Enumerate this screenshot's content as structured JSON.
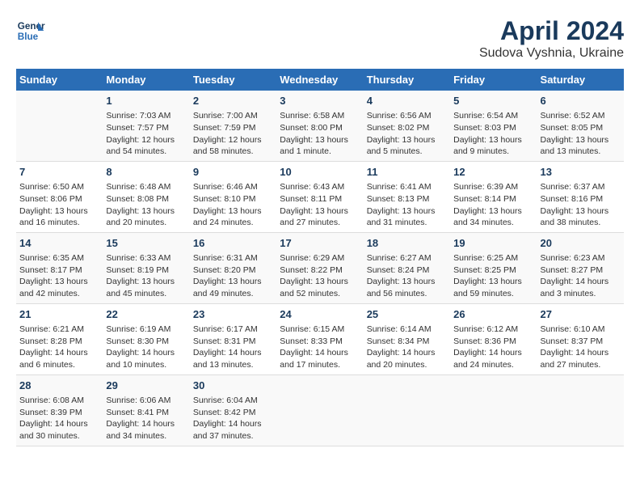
{
  "header": {
    "logo_line1": "General",
    "logo_line2": "Blue",
    "main_title": "April 2024",
    "subtitle": "Sudova Vyshnia, Ukraine"
  },
  "columns": [
    "Sunday",
    "Monday",
    "Tuesday",
    "Wednesday",
    "Thursday",
    "Friday",
    "Saturday"
  ],
  "weeks": [
    [
      {
        "num": "",
        "info": ""
      },
      {
        "num": "1",
        "info": "Sunrise: 7:03 AM\nSunset: 7:57 PM\nDaylight: 12 hours\nand 54 minutes."
      },
      {
        "num": "2",
        "info": "Sunrise: 7:00 AM\nSunset: 7:59 PM\nDaylight: 12 hours\nand 58 minutes."
      },
      {
        "num": "3",
        "info": "Sunrise: 6:58 AM\nSunset: 8:00 PM\nDaylight: 13 hours\nand 1 minute."
      },
      {
        "num": "4",
        "info": "Sunrise: 6:56 AM\nSunset: 8:02 PM\nDaylight: 13 hours\nand 5 minutes."
      },
      {
        "num": "5",
        "info": "Sunrise: 6:54 AM\nSunset: 8:03 PM\nDaylight: 13 hours\nand 9 minutes."
      },
      {
        "num": "6",
        "info": "Sunrise: 6:52 AM\nSunset: 8:05 PM\nDaylight: 13 hours\nand 13 minutes."
      }
    ],
    [
      {
        "num": "7",
        "info": "Sunrise: 6:50 AM\nSunset: 8:06 PM\nDaylight: 13 hours\nand 16 minutes."
      },
      {
        "num": "8",
        "info": "Sunrise: 6:48 AM\nSunset: 8:08 PM\nDaylight: 13 hours\nand 20 minutes."
      },
      {
        "num": "9",
        "info": "Sunrise: 6:46 AM\nSunset: 8:10 PM\nDaylight: 13 hours\nand 24 minutes."
      },
      {
        "num": "10",
        "info": "Sunrise: 6:43 AM\nSunset: 8:11 PM\nDaylight: 13 hours\nand 27 minutes."
      },
      {
        "num": "11",
        "info": "Sunrise: 6:41 AM\nSunset: 8:13 PM\nDaylight: 13 hours\nand 31 minutes."
      },
      {
        "num": "12",
        "info": "Sunrise: 6:39 AM\nSunset: 8:14 PM\nDaylight: 13 hours\nand 34 minutes."
      },
      {
        "num": "13",
        "info": "Sunrise: 6:37 AM\nSunset: 8:16 PM\nDaylight: 13 hours\nand 38 minutes."
      }
    ],
    [
      {
        "num": "14",
        "info": "Sunrise: 6:35 AM\nSunset: 8:17 PM\nDaylight: 13 hours\nand 42 minutes."
      },
      {
        "num": "15",
        "info": "Sunrise: 6:33 AM\nSunset: 8:19 PM\nDaylight: 13 hours\nand 45 minutes."
      },
      {
        "num": "16",
        "info": "Sunrise: 6:31 AM\nSunset: 8:20 PM\nDaylight: 13 hours\nand 49 minutes."
      },
      {
        "num": "17",
        "info": "Sunrise: 6:29 AM\nSunset: 8:22 PM\nDaylight: 13 hours\nand 52 minutes."
      },
      {
        "num": "18",
        "info": "Sunrise: 6:27 AM\nSunset: 8:24 PM\nDaylight: 13 hours\nand 56 minutes."
      },
      {
        "num": "19",
        "info": "Sunrise: 6:25 AM\nSunset: 8:25 PM\nDaylight: 13 hours\nand 59 minutes."
      },
      {
        "num": "20",
        "info": "Sunrise: 6:23 AM\nSunset: 8:27 PM\nDaylight: 14 hours\nand 3 minutes."
      }
    ],
    [
      {
        "num": "21",
        "info": "Sunrise: 6:21 AM\nSunset: 8:28 PM\nDaylight: 14 hours\nand 6 minutes."
      },
      {
        "num": "22",
        "info": "Sunrise: 6:19 AM\nSunset: 8:30 PM\nDaylight: 14 hours\nand 10 minutes."
      },
      {
        "num": "23",
        "info": "Sunrise: 6:17 AM\nSunset: 8:31 PM\nDaylight: 14 hours\nand 13 minutes."
      },
      {
        "num": "24",
        "info": "Sunrise: 6:15 AM\nSunset: 8:33 PM\nDaylight: 14 hours\nand 17 minutes."
      },
      {
        "num": "25",
        "info": "Sunrise: 6:14 AM\nSunset: 8:34 PM\nDaylight: 14 hours\nand 20 minutes."
      },
      {
        "num": "26",
        "info": "Sunrise: 6:12 AM\nSunset: 8:36 PM\nDaylight: 14 hours\nand 24 minutes."
      },
      {
        "num": "27",
        "info": "Sunrise: 6:10 AM\nSunset: 8:37 PM\nDaylight: 14 hours\nand 27 minutes."
      }
    ],
    [
      {
        "num": "28",
        "info": "Sunrise: 6:08 AM\nSunset: 8:39 PM\nDaylight: 14 hours\nand 30 minutes."
      },
      {
        "num": "29",
        "info": "Sunrise: 6:06 AM\nSunset: 8:41 PM\nDaylight: 14 hours\nand 34 minutes."
      },
      {
        "num": "30",
        "info": "Sunrise: 6:04 AM\nSunset: 8:42 PM\nDaylight: 14 hours\nand 37 minutes."
      },
      {
        "num": "",
        "info": ""
      },
      {
        "num": "",
        "info": ""
      },
      {
        "num": "",
        "info": ""
      },
      {
        "num": "",
        "info": ""
      }
    ]
  ]
}
